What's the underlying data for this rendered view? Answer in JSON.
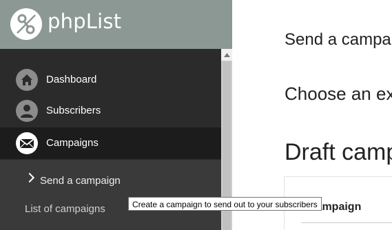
{
  "app": {
    "logo_text": "phpList"
  },
  "sidebar": {
    "items": [
      {
        "label": "Dashboard",
        "icon": "home-icon"
      },
      {
        "label": "Subscribers",
        "icon": "person-icon"
      },
      {
        "label": "Campaigns",
        "icon": "envelope-icon",
        "active": true
      }
    ],
    "subitems": [
      {
        "label": "Send a campaign",
        "current": true
      },
      {
        "label": "List of campaigns"
      }
    ]
  },
  "main": {
    "title": "Send a campa",
    "subtitle": "Choose an ex",
    "section_title": "Draft camp",
    "table": {
      "column_header": "Campaign"
    }
  },
  "tooltip": {
    "text": "Create a campaign to send out to your subscribers"
  }
}
